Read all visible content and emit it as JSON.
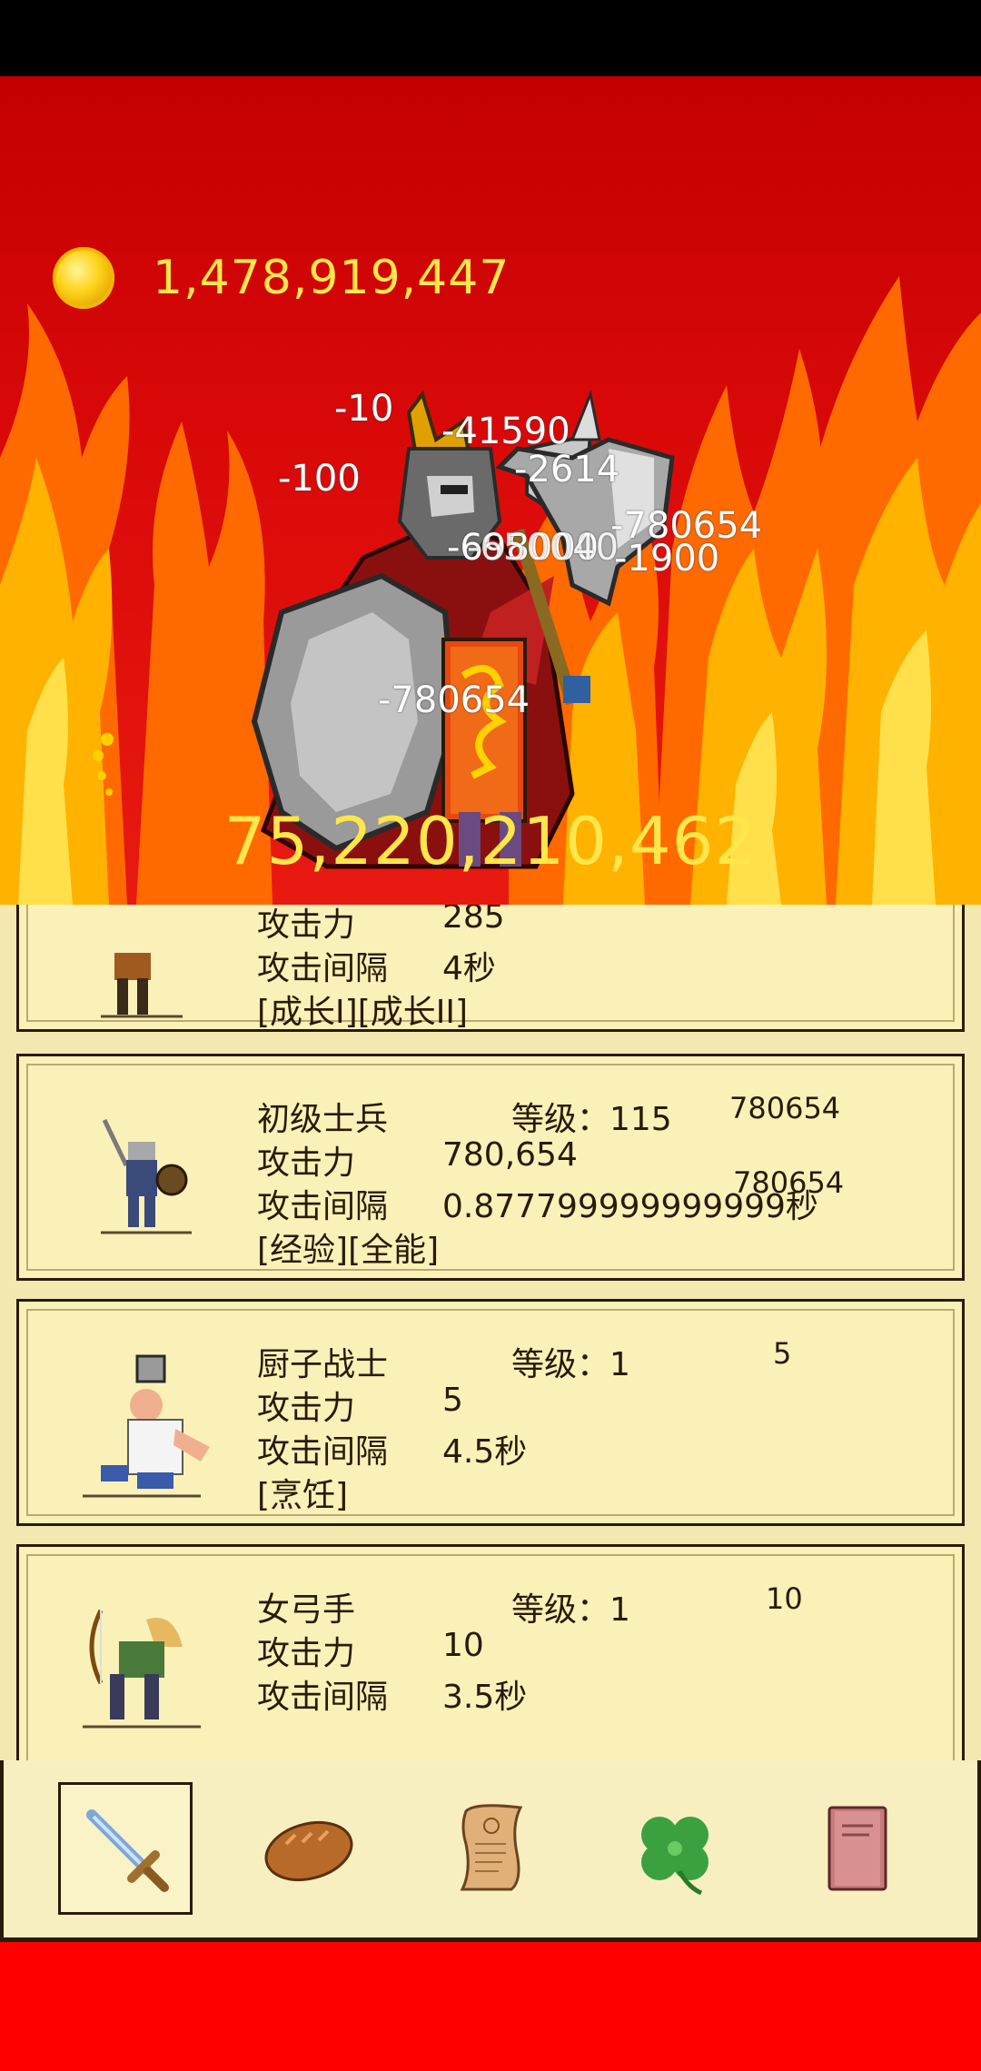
{
  "gold": {
    "value": "1,478,919,447"
  },
  "boss": {
    "hp": "75,220,210,462"
  },
  "damage_popups": [
    "-10",
    "-41590",
    "-100",
    "-2614",
    "-698000",
    "-650040",
    "-780654",
    "-1900",
    "-780654"
  ],
  "units": [
    {
      "name": "",
      "level_label": "",
      "attack_label": "攻击力",
      "attack": "285",
      "interval_label": "攻击间隔",
      "interval": "4秒",
      "tags": "[成长I][成长II]",
      "side_value": ""
    },
    {
      "name": "初级士兵",
      "level_label": "等级：115",
      "attack_label": "攻击力",
      "attack": "780,654",
      "interval_label": "攻击间隔",
      "interval": "0.877799999999999秒",
      "tags": "[经验][全能]",
      "side_value": "780654",
      "side_value2": "780654"
    },
    {
      "name": "厨子战士",
      "level_label": "等级：1",
      "attack_label": "攻击力",
      "attack": "5",
      "interval_label": "攻击间隔",
      "interval": "4.5秒",
      "tags": "[烹饪]",
      "side_value": "5"
    },
    {
      "name": "女弓手",
      "level_label": "等级：1",
      "attack_label": "攻击力",
      "attack": "10",
      "interval_label": "攻击间隔",
      "interval": "3.5秒",
      "tags": "",
      "side_value": "10"
    }
  ],
  "nav": [
    {
      "icon": "sword-icon",
      "active": true
    },
    {
      "icon": "bread-icon",
      "active": false
    },
    {
      "icon": "scroll-icon",
      "active": false
    },
    {
      "icon": "clover-icon",
      "active": false
    },
    {
      "icon": "book-icon",
      "active": false
    }
  ],
  "colors": {
    "gold_text": "#ffe64a",
    "background_red": "#ff0000",
    "card_bg": "#faf1b8"
  }
}
